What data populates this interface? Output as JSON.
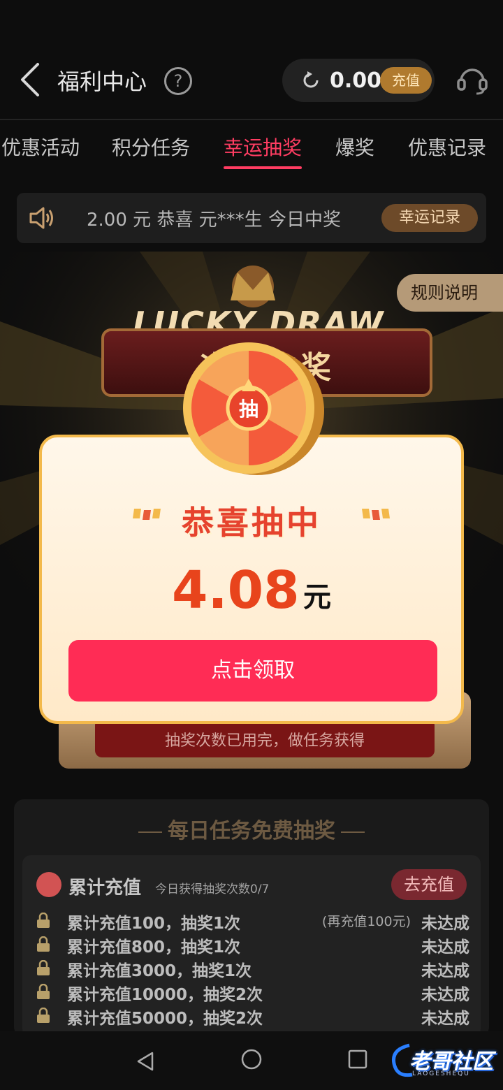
{
  "header": {
    "title": "福利中心",
    "help_glyph": "?",
    "balance": "0.00",
    "recharge_label": "充值"
  },
  "tabs": [
    {
      "label": "优惠活动",
      "active": false
    },
    {
      "label": "积分任务",
      "active": false
    },
    {
      "label": "幸运抽奖",
      "active": true
    },
    {
      "label": "爆奖",
      "active": false
    },
    {
      "label": "优惠记录",
      "active": false
    }
  ],
  "marquee": {
    "text": "2.00 元  恭喜 元***生  今日中奖",
    "record_button": "幸运记录"
  },
  "stage": {
    "rules_label": "规则说明",
    "lucky_draw_text": "LUCKY DRAW",
    "sign_text": "次次中奖",
    "board_message": "抽奖次数已用完，做任务获得",
    "coin_label": "抽"
  },
  "dialog": {
    "title": "恭喜抽中",
    "amount": "4.08",
    "unit": "元",
    "claim_button": "点击领取"
  },
  "tasks": {
    "title": "每日任务免费抽奖",
    "card": {
      "name": "累计充值",
      "subtitle": "今日获得抽奖次数0/7",
      "button": "去充值",
      "rows": [
        {
          "label": "累计充值100，抽奖1次",
          "hint": "(再充值100元)",
          "status": "未达成"
        },
        {
          "label": "累计充值800，抽奖1次",
          "hint": "",
          "status": "未达成"
        },
        {
          "label": "累计充值3000，抽奖1次",
          "hint": "",
          "status": "未达成"
        },
        {
          "label": "累计充值10000，抽奖2次",
          "hint": "",
          "status": "未达成"
        },
        {
          "label": "累计充值50000，抽奖2次",
          "hint": "",
          "status": "未达成"
        }
      ]
    }
  },
  "watermark": {
    "text": "老哥社区",
    "sub": "LAOGESHEQU"
  },
  "colors": {
    "accent": "#ff3d62",
    "claim_button": "#ff2c55",
    "amount": "#e8441c",
    "gold": "#f3b94b"
  }
}
